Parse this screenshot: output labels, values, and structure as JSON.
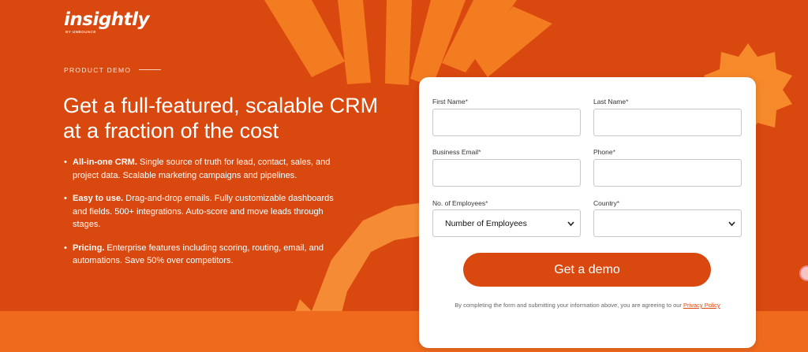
{
  "brand": {
    "logo_text": "insightly",
    "logo_subtext": "BY UNBOUNCE"
  },
  "hero": {
    "eyebrow": "PRODUCT DEMO",
    "headline": "Get a full-featured, scalable CRM at a fraction of the cost",
    "bullets": [
      {
        "bold": "All-in-one CRM.",
        "text": "Single source of truth for lead, contact, sales, and project data. Scalable marketing campaigns and pipelines."
      },
      {
        "bold": "Easy to use.",
        "text": "Drag-and-drop emails. Fully customizable dashboards and fields. 500+ integrations. Auto-score and move leads through stages."
      },
      {
        "bold": "Pricing.",
        "text": "Enterprise features including scoring, routing, email, and automations. Save 50% over competitors."
      }
    ]
  },
  "form": {
    "first_name_label": "First Name",
    "last_name_label": "Last Name",
    "email_label": "Business Email",
    "phone_label": "Phone",
    "employees_label": "No. of Employees",
    "country_label": "Country",
    "required_mark": "*",
    "first_name_value": "",
    "last_name_value": "",
    "email_value": "",
    "phone_value": "",
    "employees_selected": "Number of Employees",
    "country_selected": "",
    "submit_label": "Get a demo",
    "disclaimer_text": "By completing the form and submitting your information above, you are agreeing to our",
    "privacy_link": "Privacy Policy"
  },
  "colors": {
    "background": "#d9480f",
    "accent_light": "#f47c20",
    "accent_star": "#f6892a",
    "button": "#d9480f",
    "card": "#ffffff"
  },
  "icons": {
    "select_chevron": "chevron-down-icon",
    "help_widget": "help-widget-icon"
  }
}
